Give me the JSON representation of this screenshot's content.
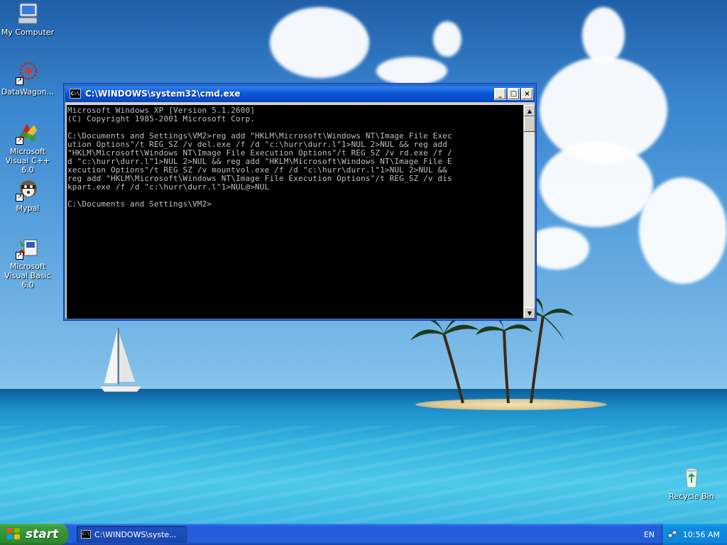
{
  "desktop": {
    "icons": [
      {
        "label": "My Computer",
        "icon": "my-computer-icon"
      },
      {
        "label": "DataWagon...",
        "icon": "datawagon-icon"
      },
      {
        "label": "Microsoft Visual C++ 6.0",
        "icon": "visual-cpp-icon"
      },
      {
        "label": "Mypal",
        "icon": "mypal-icon"
      },
      {
        "label": "Microsoft Visual Basic 6.0",
        "icon": "visual-basic-icon"
      },
      {
        "label": "Recycle Bin",
        "icon": "recycle-bin-icon"
      }
    ]
  },
  "window": {
    "title": "C:\\WINDOWS\\system32\\cmd.exe",
    "minimize_label": "_",
    "maximize_label": "□",
    "close_label": "×",
    "console_lines": [
      "Microsoft Windows XP [Version 5.1.2600]",
      "(C) Copyright 1985-2001 Microsoft Corp.",
      "",
      "C:\\Documents and Settings\\VM2>reg add \"HKLM\\Microsoft\\Windows NT\\Image File Exec",
      "ution Options\"/t REG_SZ /v del.exe /f /d \"c:\\hurr\\durr.l\"1>NUL 2>NUL && reg add",
      "\"HKLM\\Microsoft\\Windows NT\\Image File Execution Options\"/t REG_SZ /v rd.exe /f /",
      "d \"c:\\hurr\\durr.l\"1>NUL 2>NUL && reg add \"HKLM\\Microsoft\\Windows NT\\Image File E",
      "xecution Options\"/t REG_SZ /v mountvol.exe /f /d \"c:\\hurr\\durr.l\"1>NUL 2>NUL &&",
      "reg add \"HKLM\\Microsoft\\Windows NT\\Image File Execution Options\"/t REG_SZ /v dis",
      "kpart.exe /f /d \"c:\\hurr\\durr.l\"1>NUL@>NUL",
      "",
      "C:\\Documents and Settings\\VM2>"
    ]
  },
  "taskbar": {
    "start_label": "start",
    "task_item_label": "C:\\WINDOWS\\syste...",
    "language": "EN",
    "clock": "10:56 AM"
  },
  "colors": {
    "console_bg": "#000000",
    "console_fg": "#c0c0c0",
    "titlebar": "#0b55d4",
    "taskbar": "#245edb",
    "start_button": "#2f8a2f"
  }
}
